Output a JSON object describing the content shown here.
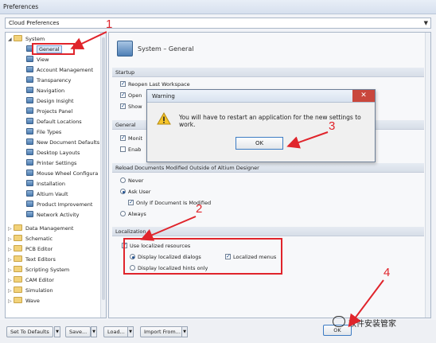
{
  "window": {
    "title": "Preferences"
  },
  "profile": {
    "value": "Cloud Preferences"
  },
  "tree": {
    "system": "System",
    "system_children": [
      "General",
      "View",
      "Account Management",
      "Transparency",
      "Navigation",
      "Design Insight",
      "Projects Panel",
      "Default Locations",
      "File Types",
      "New Document Defaults",
      "Desktop Layouts",
      "Printer Settings",
      "Mouse Wheel Configura",
      "Installation",
      "Altium Vault",
      "Product Improvement",
      "Network Activity"
    ],
    "folders": [
      "Data Management",
      "Schematic",
      "PCB Editor",
      "Text Editors",
      "Scripting System",
      "CAM Editor",
      "Simulation",
      "Wave"
    ]
  },
  "panel": {
    "title": "System – General",
    "startup": {
      "header": "Startup",
      "reopen": "Reopen Last Workspace",
      "open_partial": "Open",
      "show_partial": "Show"
    },
    "general": {
      "header": "General",
      "moni_partial": "Monit",
      "enab_partial": "Enab"
    },
    "reload": {
      "header": "Reload Documents Modified Outside of Altium Designer",
      "never": "Never",
      "ask": "Ask User",
      "only_modified": "Only If Document Is Modified",
      "always": "Always"
    },
    "localization": {
      "header": "Localization",
      "use_resources": "Use localized resources",
      "dialogs": "Display localized dialogs",
      "menus": "Localized menus",
      "hints": "Display localized hints only"
    }
  },
  "dialog": {
    "title": "Warning",
    "close": "✕",
    "message": "You will have to restart an application for the new settings to work.",
    "ok": "OK"
  },
  "bottom": {
    "set_defaults": "Set To Defaults",
    "save": "Save...",
    "load": "Load...",
    "import": "Import From...",
    "ok": "OK"
  },
  "callouts": {
    "one": "1",
    "two": "2",
    "three": "3",
    "four": "4"
  },
  "watermark": {
    "text": "软件安装管家"
  },
  "colors": {
    "annotation": "#e0242b",
    "accent": "#3d7cc4"
  }
}
